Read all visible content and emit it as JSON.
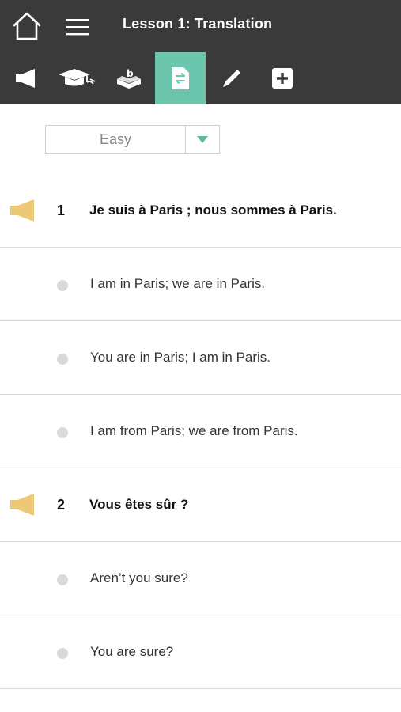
{
  "header": {
    "title": "Lesson 1: Translation",
    "home_icon": "home-icon",
    "menu_icon": "hamburger-menu-icon"
  },
  "toolbar": {
    "active_color": "#6cc5ad",
    "tools": [
      {
        "icon": "megaphone-icon",
        "active": false
      },
      {
        "icon": "graduation-cap-icon",
        "active": false
      },
      {
        "icon": "vocabulary-box-icon",
        "active": false
      },
      {
        "icon": "translation-document-icon",
        "active": true
      },
      {
        "icon": "pencil-icon",
        "active": false
      },
      {
        "icon": "plus-square-icon",
        "active": false
      }
    ]
  },
  "difficulty": {
    "selected": "Easy",
    "arrow_color": "#5bb89f"
  },
  "exercises": [
    {
      "number": "1",
      "question": "Je suis à Paris ; nous sommes à Paris.",
      "options": [
        "I am in Paris; we are in Paris.",
        "You are in Paris; I am in Paris.",
        "I am from Paris; we are from Paris."
      ]
    },
    {
      "number": "2",
      "question": "Vous êtes sûr ?",
      "options": [
        "Aren’t you sure?",
        "You are sure?"
      ]
    }
  ],
  "colors": {
    "header_bg": "#3a3a3a",
    "speaker": "#ecc977",
    "bullet": "#d9d9d9"
  }
}
